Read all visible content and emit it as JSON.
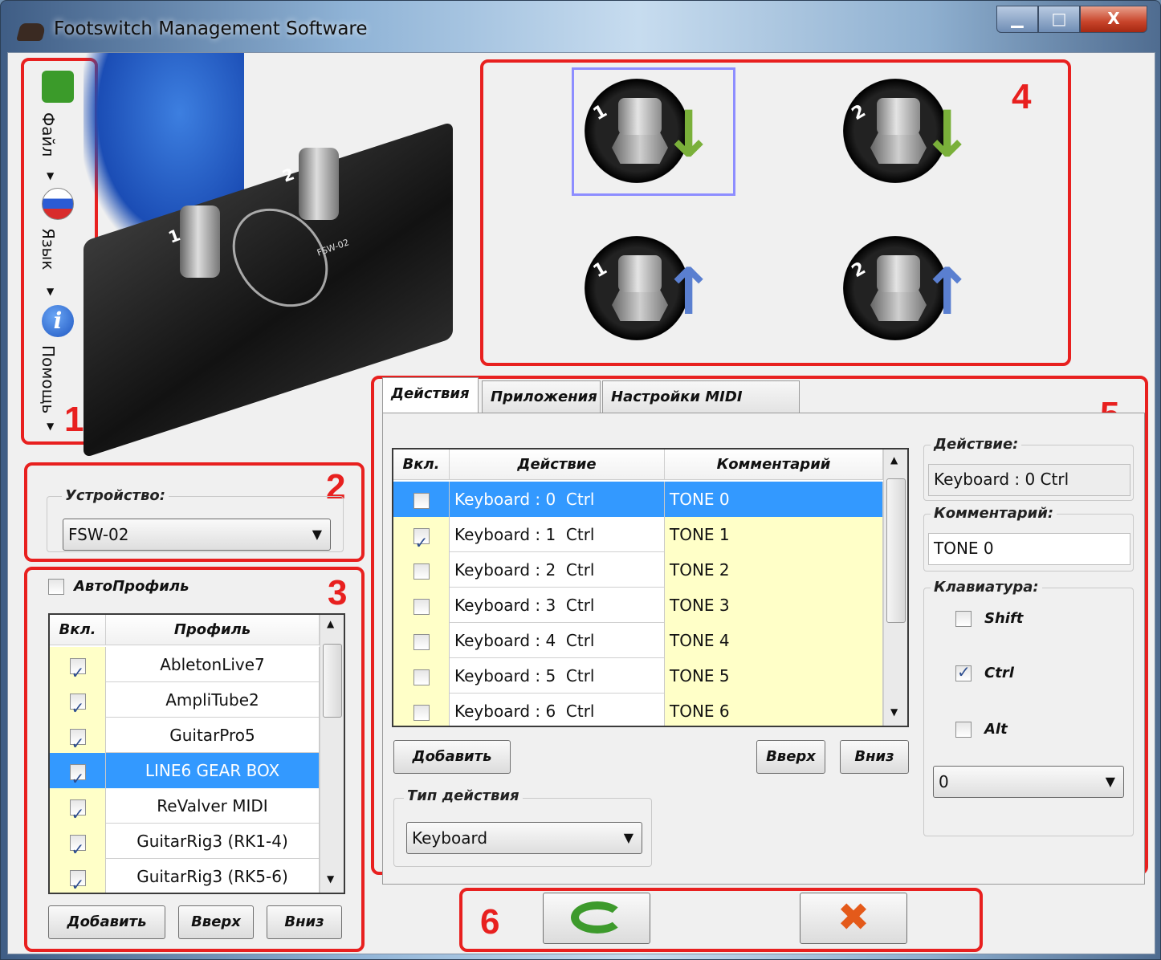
{
  "window": {
    "title": "Footswitch Management Software",
    "minimize_label": "▁",
    "maximize_label": "□",
    "close_label": "X"
  },
  "toolbar": {
    "items": [
      {
        "label": "Файл",
        "icon": "save-icon"
      },
      {
        "label": "Язык",
        "icon": "russian-flag-icon"
      },
      {
        "label": "Помощь",
        "icon": "info-icon"
      }
    ]
  },
  "annotations": [
    "1",
    "2",
    "3",
    "4",
    "5",
    "6"
  ],
  "device": {
    "label": "Устройство:",
    "selected": "FSW-02",
    "image_labels": {
      "pedal_1": "1",
      "pedal_2": "2",
      "model": "FSW-02"
    }
  },
  "profiles": {
    "autoprofile_label": "АвтоПрофиль",
    "autoprofile_checked": false,
    "headers": [
      "Вкл.",
      "Профиль"
    ],
    "rows": [
      {
        "name": "AbletonLive7",
        "on": true,
        "selected": false
      },
      {
        "name": "AmpliTube2",
        "on": true,
        "selected": false
      },
      {
        "name": "GuitarPro5",
        "on": true,
        "selected": false
      },
      {
        "name": "LINE6 GEAR BOX",
        "on": true,
        "selected": true
      },
      {
        "name": "ReValver MIDI",
        "on": true,
        "selected": false
      },
      {
        "name": "GuitarRig3 (RK1-4)",
        "on": true,
        "selected": false
      },
      {
        "name": "GuitarRig3 (RK5-6)",
        "on": true,
        "selected": false
      }
    ],
    "add_label": "Добавить",
    "up_label": "Вверх",
    "down_label": "Вниз"
  },
  "pedals": [
    {
      "number": "1",
      "direction": "down",
      "selected": true
    },
    {
      "number": "2",
      "direction": "down",
      "selected": false
    },
    {
      "number": "1",
      "direction": "up",
      "selected": false
    },
    {
      "number": "2",
      "direction": "up",
      "selected": false
    }
  ],
  "tabs": [
    "Действия",
    "Приложения",
    "Настройки MIDI порта"
  ],
  "actions": {
    "headers": [
      "Вкл.",
      "Действие",
      "Комментарий"
    ],
    "rows": [
      {
        "on": false,
        "action": "Keyboard : 0  Ctrl",
        "comment": "TONE 0",
        "selected": true
      },
      {
        "on": true,
        "action": "Keyboard : 1  Ctrl",
        "comment": "TONE 1",
        "selected": false
      },
      {
        "on": false,
        "action": "Keyboard : 2  Ctrl",
        "comment": "TONE 2",
        "selected": false
      },
      {
        "on": false,
        "action": "Keyboard : 3  Ctrl",
        "comment": "TONE 3",
        "selected": false
      },
      {
        "on": false,
        "action": "Keyboard : 4  Ctrl",
        "comment": "TONE 4",
        "selected": false
      },
      {
        "on": false,
        "action": "Keyboard : 5  Ctrl",
        "comment": "TONE 5",
        "selected": false
      },
      {
        "on": false,
        "action": "Keyboard : 6  Ctrl",
        "comment": "TONE 6",
        "selected": false
      }
    ],
    "add_label": "Добавить",
    "up_label": "Вверх",
    "down_label": "Вниз",
    "type_label": "Тип действия",
    "type_value": "Keyboard"
  },
  "details": {
    "action_label": "Действие:",
    "action_value": "Keyboard : 0  Ctrl",
    "comment_label": "Комментарий:",
    "comment_value": "TONE 0",
    "keyboard_label": "Клавиатура:",
    "shift_label": "Shift",
    "shift": false,
    "ctrl_label": "Ctrl",
    "ctrl": true,
    "alt_label": "Alt",
    "alt": false,
    "key_value": "0"
  },
  "footer": {
    "apply_icon": "apply-arrow-icon",
    "cancel_icon": "cancel-x-icon"
  },
  "colors": {
    "accent": "#3399ff",
    "annotation": "#e8201f",
    "comment_bg": "#ffffc8",
    "arrow_down": "#7ab03a",
    "arrow_up": "#5a7fd0"
  }
}
